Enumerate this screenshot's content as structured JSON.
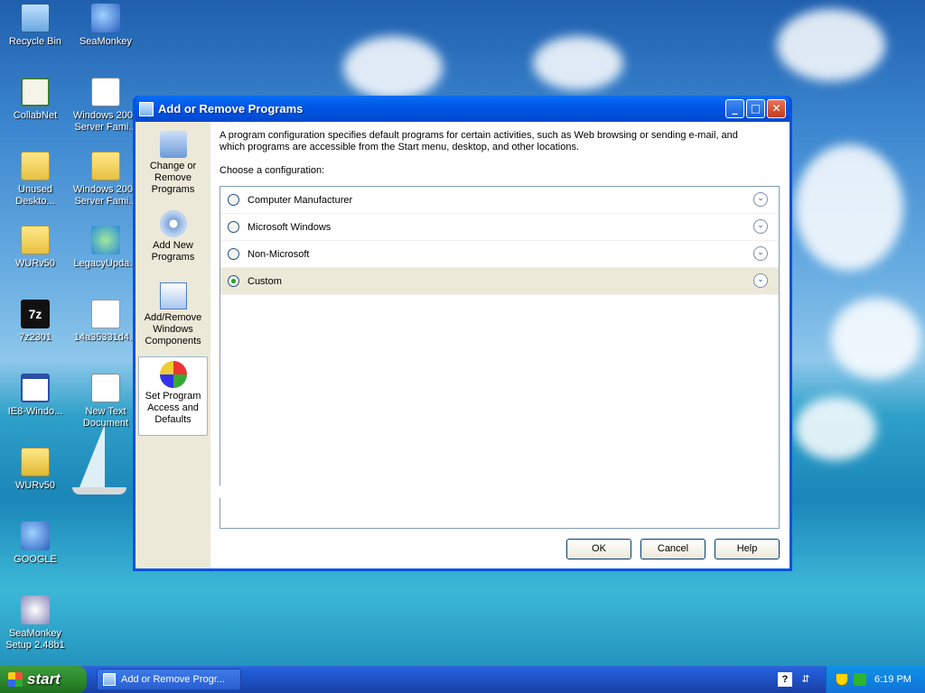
{
  "desktop": {
    "icons": [
      {
        "label": "Recycle Bin",
        "icon": "recycle-bin-icon"
      },
      {
        "label": "SeaMonkey",
        "icon": "seamonkey-icon"
      },
      {
        "label": "CollabNet",
        "icon": "collabnet-icon"
      },
      {
        "label": "Windows 2000 Server Fami...",
        "icon": "document-icon"
      },
      {
        "label": "Unused Deskto...",
        "icon": "folder-icon"
      },
      {
        "label": "Windows 2000 Server Fami...",
        "icon": "folder-icon"
      },
      {
        "label": "WURv50",
        "icon": "folder-icon"
      },
      {
        "label": "LegacyUpda...",
        "icon": "update-icon"
      },
      {
        "label": "7z2301",
        "icon": "7zip-icon"
      },
      {
        "label": "14a35331d4...",
        "icon": "media-file-icon"
      },
      {
        "label": "IE8-Windo...",
        "icon": "window-app-icon"
      },
      {
        "label": "New Text Document",
        "icon": "text-document-icon"
      },
      {
        "label": "WURv50",
        "icon": "zip-folder-icon"
      },
      {
        "label": "GOOGLE",
        "icon": "seamonkey-icon"
      },
      {
        "label": "SeaMonkey Setup 2.48b1",
        "icon": "installer-icon"
      }
    ]
  },
  "window": {
    "title": "Add or Remove Programs",
    "controls": {
      "minimize": "_",
      "maximize": "□",
      "close": "✕"
    },
    "nav": [
      {
        "label": "Change or Remove Programs",
        "icon": "change-remove-programs-icon",
        "selected": false
      },
      {
        "label": "Add New Programs",
        "icon": "add-new-programs-icon",
        "selected": false
      },
      {
        "label": "Add/Remove Windows Components",
        "icon": "windows-components-icon",
        "selected": false
      },
      {
        "label": "Set Program Access and Defaults",
        "icon": "program-access-defaults-icon",
        "selected": true
      }
    ],
    "description": "A program configuration specifies default programs for certain activities, such as Web browsing or sending e-mail, and which programs are accessible from the Start menu, desktop, and other locations.",
    "choose_label": "Choose a configuration:",
    "options": [
      {
        "label": "Computer Manufacturer",
        "selected": false
      },
      {
        "label": "Microsoft Windows",
        "selected": false
      },
      {
        "label": "Non-Microsoft",
        "selected": false
      },
      {
        "label": "Custom",
        "selected": true
      }
    ],
    "expand_glyph": "⌄",
    "buttons": {
      "ok": "OK",
      "cancel": "Cancel",
      "help": "Help"
    }
  },
  "taskbar": {
    "start_label": "start",
    "task_label": "Add or Remove Progr...",
    "help_glyph": "?",
    "clock": "6:19 PM"
  },
  "colors": {
    "titlebar": "#0058e6",
    "dialog_face": "#ece9d8",
    "taskbar": "#245edb",
    "start_green": "#2e8b2e",
    "radio_selected": "#21a121"
  }
}
